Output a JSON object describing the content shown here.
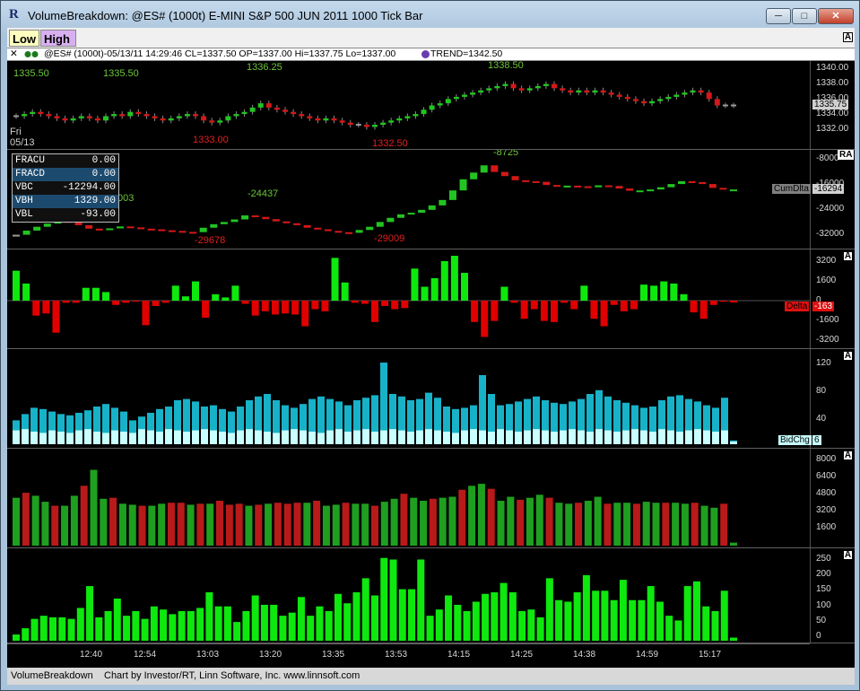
{
  "window": {
    "title": "VolumeBreakdown: @ES# (1000t) E-MINI S&P 500 JUN 2011 1000 Tick Bar",
    "min": "─",
    "max": "□",
    "close": "✕"
  },
  "toolbar": {
    "low": "Low",
    "high": "High",
    "a_mark": "A"
  },
  "info": {
    "close": "✕",
    "text": "@ES# (1000t)-05/13/11 14:29:46 CL=1337.50 OP=1337.00 Hi=1337.75 Lo=1337.00",
    "trend": "TREND=1342.50"
  },
  "colors": {
    "up": "#22c422",
    "down": "#d41818",
    "buy": "#17b2c8",
    "sell": "#c8ffff",
    "green_bar": "#0ee80e",
    "vol_green": "#1f9f1f",
    "vol_red": "#b81a1a"
  },
  "price_pane": {
    "button": "A",
    "ticks": [
      "1340.00",
      "1338.00",
      "1336.00",
      "1334.00",
      "1332.00"
    ],
    "last": "1335.75",
    "day": "Fri",
    "date": "05/13",
    "labels": [
      "1335.50",
      "1335.50",
      "1336.25",
      "1333.00",
      "1332.50",
      "1338.50"
    ]
  },
  "cum_pane": {
    "button": "RA",
    "ticks": [
      "-8000",
      "-16000",
      "-24000",
      "-32000"
    ],
    "name": "CumDlta",
    "last": "-16294",
    "labels": [
      "-24437",
      "-29678",
      "-29009",
      "-8725",
      "003"
    ],
    "table": [
      {
        "k": "FRACU",
        "v": "0.00"
      },
      {
        "k": "FRACD",
        "v": "0.00"
      },
      {
        "k": "VBC",
        "v": "-12294.00"
      },
      {
        "k": "VBH",
        "v": "1329.00"
      },
      {
        "k": "VBL",
        "v": "-93.00"
      }
    ]
  },
  "delta_pane": {
    "button": "A",
    "ticks": [
      "3200",
      "1600",
      "0",
      "-1600",
      "-3200"
    ],
    "name": "Delta",
    "last": "-163"
  },
  "bidask_pane": {
    "button": "A",
    "ticks": [
      "120",
      "80",
      "40"
    ],
    "name": "BidChg",
    "last": "6"
  },
  "volume_pane": {
    "button": "A",
    "ticks": [
      "8000",
      "6400",
      "4800",
      "3200",
      "1600"
    ]
  },
  "count_pane": {
    "button": "A",
    "ticks": [
      "250",
      "200",
      "150",
      "100",
      "50",
      "0"
    ]
  },
  "time_axis": [
    "12:40",
    "12:54",
    "13:03",
    "13:20",
    "13:35",
    "13:53",
    "14:15",
    "14:25",
    "14:38",
    "14:59",
    "15:17"
  ],
  "status": {
    "name": "VolumeBreakdown",
    "credit": "Chart by Investor/RT, Linn Software, Inc. www.linnsoft.com"
  },
  "chart_data": [
    {
      "type": "candlestick",
      "title": "@ES# (1000t)",
      "ylim": [
        1331,
        1340.5
      ],
      "close": [
        1334.5,
        1334.75,
        1335,
        1334.75,
        1334.5,
        1334.25,
        1334,
        1334.25,
        1334.5,
        1334.25,
        1334,
        1334.5,
        1334.75,
        1334.5,
        1335,
        1334.75,
        1334.5,
        1334.25,
        1334,
        1334.25,
        1334.5,
        1334.75,
        1334.5,
        1334,
        1333.75,
        1334,
        1334.5,
        1334.75,
        1335,
        1335.5,
        1336,
        1335.5,
        1335.25,
        1335,
        1334.75,
        1334.5,
        1334.25,
        1334,
        1334.25,
        1334,
        1333.75,
        1333.5,
        1333.5,
        1333.25,
        1333.5,
        1333.75,
        1334,
        1334.25,
        1334.5,
        1334.75,
        1335.25,
        1335.75,
        1336,
        1336.5,
        1336.75,
        1337,
        1337.25,
        1337.5,
        1337.75,
        1338,
        1338.25,
        1337.75,
        1337.5,
        1337.75,
        1338,
        1338.25,
        1337.75,
        1337.5,
        1337.25,
        1337.5,
        1337.25,
        1337.5,
        1337.25,
        1337,
        1336.75,
        1336.5,
        1336.25,
        1336,
        1336.25,
        1336.5,
        1336.75,
        1337,
        1337.25,
        1337.5,
        1337.25,
        1336.5,
        1335.75,
        1335.75,
        1335.75
      ]
    },
    {
      "type": "line",
      "series": [
        {
          "name": "CumDlta",
          "values": [
            -30500,
            -29200,
            -28000,
            -27000,
            -26200,
            -26400,
            -27500,
            -28600,
            -29000,
            -28500,
            -27900,
            -28200,
            -28600,
            -28800,
            -29100,
            -29300,
            -29600,
            -29678,
            -28300,
            -27200,
            -26500,
            -25700,
            -24437,
            -24900,
            -25600,
            -26300,
            -26900,
            -27500,
            -28300,
            -28800,
            -29300,
            -29700,
            -29900,
            -29009,
            -28000,
            -26500,
            -25200,
            -24100,
            -23600,
            -22700,
            -21300,
            -19600,
            -16600,
            -13100,
            -11000,
            -8725,
            -10800,
            -12100,
            -13400,
            -13700,
            -13900,
            -14900,
            -15300,
            -15100,
            -15300,
            -15600,
            -15000,
            -15200,
            -16000,
            -16700,
            -16600,
            -16300,
            -15600,
            -14600,
            -13700,
            -14000,
            -14600,
            -15800,
            -16300,
            -16294
          ]
        }
      ]
    },
    {
      "type": "bar",
      "series": [
        {
          "name": "Delta",
          "values": [
            2800,
            1600,
            -1400,
            -1200,
            -3000,
            -200,
            -200,
            1200,
            1200,
            800,
            -400,
            -200,
            -100,
            -2300,
            -500,
            -200,
            1400,
            400,
            1800,
            -1600,
            600,
            300,
            1400,
            -300,
            -1400,
            -1000,
            -1300,
            -1200,
            -1300,
            -2400,
            -800,
            -1000,
            4000,
            1700,
            -200,
            -300,
            -2000,
            -500,
            -800,
            -700,
            3000,
            1300,
            2100,
            3700,
            4200,
            2600,
            -2000,
            -3400,
            -1900,
            1300,
            -200,
            -1700,
            -800,
            -1900,
            -2000,
            -200,
            -800,
            1400,
            -1700,
            -2400,
            -400,
            -1000,
            -800,
            1500,
            1400,
            1800,
            1600,
            600,
            -1100,
            -1700,
            -400,
            -100,
            -163
          ]
        }
      ]
    },
    {
      "type": "bar",
      "series": [
        {
          "name": "Ask",
          "values": [
            38,
            48,
            58,
            56,
            52,
            48,
            46,
            50,
            54,
            60,
            64,
            58,
            52,
            38,
            44,
            50,
            56,
            60,
            70,
            72,
            68,
            60,
            62,
            56,
            52,
            60,
            70,
            76,
            80,
            70,
            62,
            58,
            64,
            72,
            76,
            72,
            68,
            62,
            70,
            74,
            78,
            130,
            80,
            76,
            70,
            72,
            82,
            74,
            60,
            56,
            58,
            62,
            110,
            80,
            62,
            64,
            68,
            72,
            76,
            70,
            66,
            64,
            68,
            72,
            80,
            86,
            76,
            70,
            66,
            62,
            58,
            60,
            70,
            76,
            78,
            72,
            68,
            62,
            58,
            74,
            6
          ]
        },
        {
          "name": "Bid",
          "values": [
            22,
            24,
            20,
            18,
            22,
            20,
            18,
            22,
            24,
            20,
            18,
            22,
            20,
            18,
            24,
            22,
            20,
            24,
            22,
            20,
            22,
            24,
            22,
            20,
            18,
            22,
            24,
            22,
            20,
            18,
            22,
            24,
            22,
            20,
            18,
            22,
            24,
            20,
            22,
            24,
            20,
            22,
            24,
            22,
            20,
            22,
            24,
            22,
            20,
            18,
            22,
            24,
            22,
            20,
            24,
            22,
            20,
            22,
            24,
            22,
            20,
            22,
            24,
            22,
            20,
            24,
            22,
            20,
            22,
            24,
            22,
            20,
            24,
            22,
            20,
            22,
            24,
            22,
            20,
            22,
            4
          ]
        }
      ]
    },
    {
      "type": "bar",
      "series": [
        {
          "name": "Volume",
          "values": [
            4800,
            5300,
            5000,
            4400,
            4000,
            4000,
            5000,
            6000,
            7600,
            4700,
            4800,
            4200,
            4100,
            4000,
            4000,
            4200,
            4300,
            4300,
            4100,
            4200,
            4200,
            4500,
            4100,
            4200,
            4000,
            4100,
            4200,
            4300,
            4200,
            4300,
            4300,
            4500,
            4000,
            4100,
            4300,
            4200,
            4200,
            4000,
            4400,
            4700,
            5200,
            4800,
            4500,
            4700,
            4800,
            4900,
            5600,
            6000,
            6200,
            5700,
            4500,
            4900,
            4600,
            4800,
            5100,
            4800,
            4300,
            4200,
            4300,
            4500,
            4900,
            4200,
            4300,
            4300,
            4200,
            4400,
            4300,
            4300,
            4300,
            4200,
            4300,
            4000,
            3800,
            4200,
            300
          ]
        }
      ]
    },
    {
      "type": "bar",
      "series": [
        {
          "name": "Count",
          "values": [
            20,
            40,
            70,
            80,
            75,
            75,
            70,
            105,
            175,
            75,
            95,
            135,
            80,
            95,
            70,
            110,
            100,
            85,
            95,
            95,
            105,
            155,
            110,
            110,
            60,
            95,
            145,
            115,
            115,
            80,
            90,
            140,
            80,
            110,
            95,
            150,
            120,
            155,
            200,
            145,
            265,
            260,
            165,
            165,
            260,
            80,
            100,
            145,
            115,
            95,
            125,
            150,
            155,
            185,
            155,
            95,
            100,
            75,
            200,
            130,
            125,
            155,
            210,
            160,
            160,
            130,
            195,
            130,
            130,
            175,
            125,
            80,
            65,
            175,
            190,
            110,
            95,
            160,
            10
          ]
        }
      ]
    }
  ]
}
